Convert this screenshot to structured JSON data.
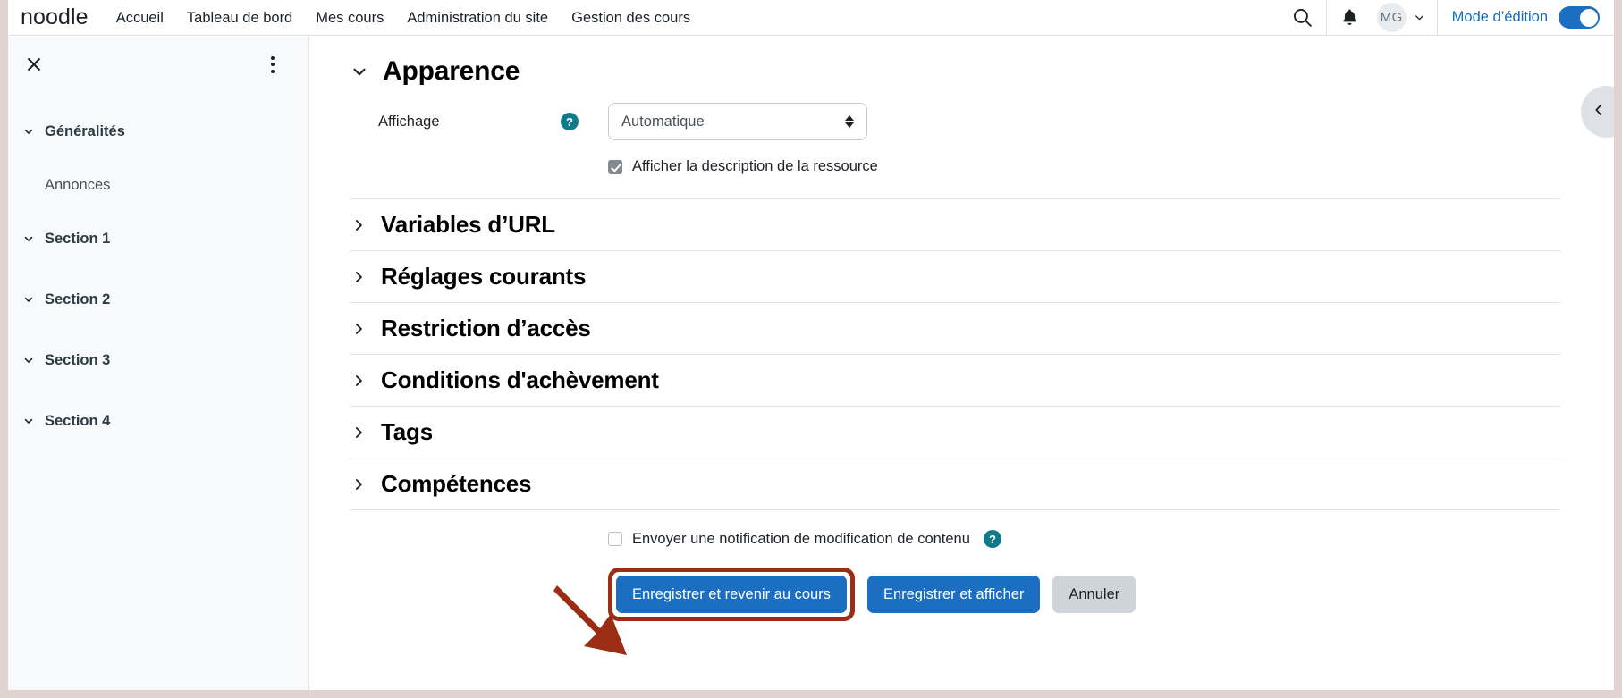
{
  "navbar": {
    "brand": "noodle",
    "links": [
      {
        "label": "Accueil"
      },
      {
        "label": "Tableau de bord"
      },
      {
        "label": "Mes cours"
      },
      {
        "label": "Administration du site"
      },
      {
        "label": "Gestion des cours"
      }
    ],
    "search_icon": "search-icon",
    "notifications_icon": "bell-icon",
    "avatar_initials": "MG",
    "avatar_chevron": "chevron-down-icon",
    "edit_mode_label": "Mode d’édition",
    "edit_mode_enabled": true,
    "accent_blue": "#1b6ec2",
    "link_blue": "#0f6cbf"
  },
  "sidebar": {
    "close_icon": "close-icon",
    "menu_icon": "kebab-menu-icon",
    "items": [
      {
        "label": "Généralités",
        "type": "section",
        "expanded": true
      },
      {
        "label": "Annonces",
        "type": "activity"
      },
      {
        "label": "Section 1",
        "type": "section",
        "expanded": true
      },
      {
        "label": "Section 2",
        "type": "section",
        "expanded": true
      },
      {
        "label": "Section 3",
        "type": "section",
        "expanded": true
      },
      {
        "label": "Section 4",
        "type": "section",
        "expanded": true
      }
    ]
  },
  "main": {
    "appearance": {
      "title": "Apparence",
      "expanded": true,
      "display_field": {
        "label": "Affichage",
        "help_icon": "help-circle-icon",
        "help_color": "#0f7b8a",
        "selected_value": "Automatique",
        "options": [
          "Automatique"
        ]
      },
      "show_description": {
        "label": "Afficher la description de la ressource",
        "checked": true
      }
    },
    "collapsed_sections": [
      {
        "label": "Variables d’URL"
      },
      {
        "label": "Réglages courants"
      },
      {
        "label": "Restriction d’accès"
      },
      {
        "label": "Conditions d'achèvement"
      },
      {
        "label": "Tags"
      },
      {
        "label": "Compétences"
      }
    ],
    "footer": {
      "notify_checkbox": {
        "label": "Envoyer une notification de modification de contenu",
        "checked": false,
        "help_icon": "help-circle-icon"
      },
      "buttons": [
        {
          "label": "Enregistrer et revenir au cours",
          "style": "primary",
          "highlighted": true
        },
        {
          "label": "Enregistrer et afficher",
          "style": "primary",
          "highlighted": false
        },
        {
          "label": "Annuler",
          "style": "secondary",
          "highlighted": false
        }
      ]
    }
  },
  "annotation": {
    "arrow_icon": "arrow-pointing-down-right",
    "color": "#9b2d15",
    "target": "Enregistrer et revenir au cours"
  },
  "drawer_toggle": {
    "icon": "chevron-left-icon"
  }
}
